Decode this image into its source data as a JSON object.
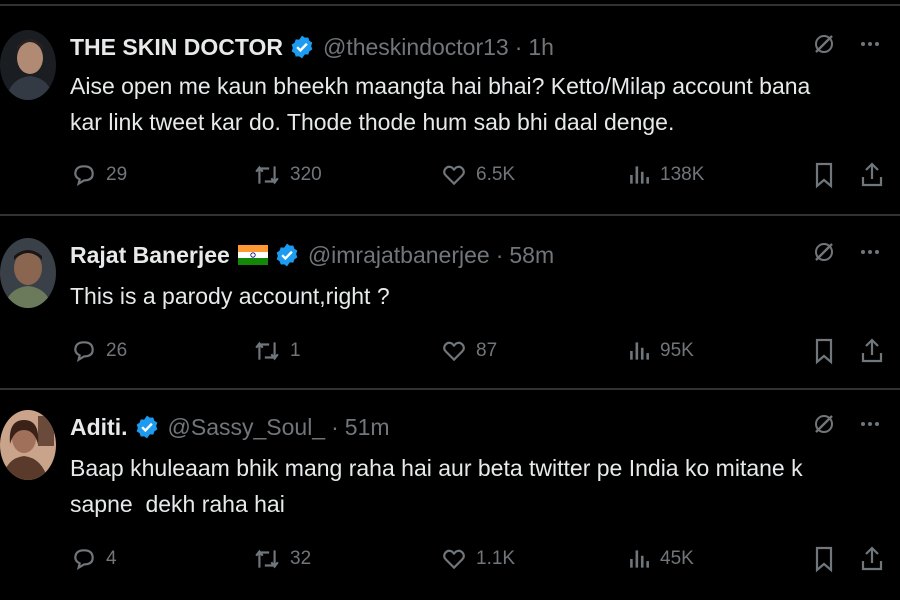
{
  "tweets": [
    {
      "name": "THE SKIN DOCTOR",
      "handle": "@theskindoctor13",
      "time": "1h",
      "text_lines": [
        "Aise open me kaun bheekh maangta hai bhai? Ketto/Milap account bana",
        "kar link tweet kar do. Thode thode hum sab bhi daal denge."
      ],
      "replies": "29",
      "reposts": "320",
      "likes": "6.5K",
      "views": "138K",
      "has_flag": false
    },
    {
      "name": "Rajat Banerjee",
      "handle": "@imrajatbanerjee",
      "time": "58m",
      "text_lines": [
        "This is a parody account,right ?"
      ],
      "replies": "26",
      "reposts": "1",
      "likes": "87",
      "views": "95K",
      "has_flag": true
    },
    {
      "name": "Aditi.",
      "handle": "@Sassy_Soul_",
      "time": "51m",
      "text_lines": [
        "Baap khuleaam bhik mang raha hai aur beta twitter pe India ko mitane k",
        "sapne  dekh raha hai"
      ],
      "replies": "4",
      "reposts": "32",
      "likes": "1.1K",
      "views": "45K",
      "has_flag": false
    }
  ],
  "separator": "·",
  "colors": {
    "background": "#000000",
    "text": "#e7e9ea",
    "muted": "#71767b",
    "verified": "#1d9bf0",
    "divider": "#2f3336"
  },
  "icons": [
    "grok-icon",
    "more-icon",
    "reply-icon",
    "repost-icon",
    "like-icon",
    "views-icon",
    "bookmark-icon",
    "share-icon",
    "verified-badge-icon",
    "india-flag-icon"
  ]
}
